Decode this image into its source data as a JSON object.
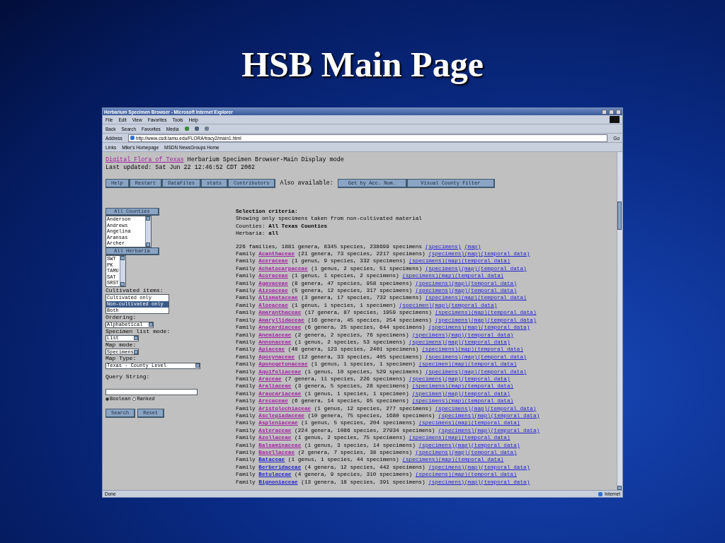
{
  "slide": {
    "title": "HSB Main Page"
  },
  "browser": {
    "title": "Herbarium Specimen Browser - Microsoft Internet Explorer",
    "menus": [
      "File",
      "Edit",
      "View",
      "Favorites",
      "Tools",
      "Help"
    ],
    "toolbar": [
      "Back",
      "Search",
      "Favorites",
      "Media"
    ],
    "address_label": "Address",
    "address": "http://www.csdl.tamu.edu/FLORA/tracy2/main1.html",
    "go": "Go",
    "links_label": "Links",
    "links": [
      "Mike's Homepage",
      "MSDN NewsGroups Home"
    ],
    "status": "Done",
    "zone": "Internet"
  },
  "page": {
    "site_link": "Digital Flora of Texas",
    "heading": "Herbarium Specimen Browser-Main Display mode",
    "updated": "Last updated: Sat Jun 22 12:46:52 CDT 2002",
    "nav_buttons": [
      "Help",
      "Restart",
      "DataFiles",
      "stats",
      "Contributors"
    ],
    "also_label": "Also available:",
    "extra_buttons": [
      "Get by Acc. Num.",
      "Visual County Filter"
    ],
    "form": {
      "counties_button": "All Counties",
      "counties": [
        "Anderson",
        "Andrews",
        "Angelina",
        "Aransas",
        "Archer"
      ],
      "herbaria_button": "All Herbaria",
      "herbaria": [
        "SWT",
        "PK",
        "TAMU",
        "SAT",
        "SRST"
      ],
      "cultivated_label": "Cultivated items:",
      "cultivated_options": [
        {
          "label": "Cultivated only",
          "selected": false
        },
        {
          "label": "Non-cultivated only",
          "selected": true
        },
        {
          "label": "Both",
          "selected": false
        }
      ],
      "ordering_label": "Ordering:",
      "ordering": "Alphabetical",
      "list_mode_label": "Specimen list mode:",
      "list_mode": "List",
      "map_mode_label": "Map mode:",
      "map_mode": "Specimens",
      "map_type_label": "Map Type:",
      "map_type": "Texas - County Level",
      "query_label": "Query String:",
      "query_modes": [
        {
          "label": "Boolean",
          "selected": true
        },
        {
          "label": "Ranked",
          "selected": false
        }
      ],
      "search_button": "Search",
      "reset_button": "Reset"
    },
    "results": {
      "criteria_title": "Selection criteria:",
      "criteria": "Showing only specimens taken from non-cultivated material",
      "counties_label": "Counties:",
      "counties_value": "All Texas Counties",
      "herbaria_label": "Herbaria:",
      "herbaria_value": "all",
      "summary": "226 families, 1881 genera, 8345 species, 238699 specimens",
      "summary_links": [
        "(specimens)",
        "(map)"
      ],
      "families": [
        {
          "prefix": "Family",
          "name": "Acanthaceae",
          "visited": true,
          "counts": "(21 genera, 73 species, 2217 specimens)",
          "links": [
            "(specimens)",
            "(map)",
            "(temporal data)"
          ]
        },
        {
          "prefix": "Family",
          "name": "Aceraceae",
          "visited": true,
          "counts": "(1 genus, 9 species, 332 specimens)",
          "links": [
            "(specimens)",
            "(map)",
            "(temporal data)"
          ]
        },
        {
          "prefix": "Family",
          "name": "Achatocarpaceae",
          "visited": true,
          "counts": "(1 genus, 2 species, 51 specimens)",
          "links": [
            "(specimens)",
            "(map)",
            "(temporal data)"
          ]
        },
        {
          "prefix": "Family",
          "name": "Acoraceae",
          "visited": true,
          "counts": "(1 genus, 1 species, 2 specimens)",
          "links": [
            "(specimens)",
            "(map)",
            "(temporal data)"
          ]
        },
        {
          "prefix": "Family",
          "name": "Agavaceae",
          "visited": true,
          "counts": "(8 genera, 47 species, 958 specimens)",
          "links": [
            "(specimens)",
            "(map)",
            "(temporal data)"
          ]
        },
        {
          "prefix": "Family",
          "name": "Aizoaceae",
          "visited": true,
          "counts": "(5 genera, 12 species, 317 specimens)",
          "links": [
            "(specimens)",
            "(map)",
            "(temporal data)"
          ]
        },
        {
          "prefix": "Family",
          "name": "Alismataceae",
          "visited": true,
          "counts": "(3 genera, 17 species, 732 specimens)",
          "links": [
            "(specimens)",
            "(map)",
            "(temporal data)"
          ]
        },
        {
          "prefix": "Family",
          "name": "Aloeaceae",
          "visited": true,
          "counts": "(1 genus, 1 species, 1 specimen)",
          "links": [
            "(specimen)",
            "(map)",
            "(temporal data)"
          ]
        },
        {
          "prefix": "Family",
          "name": "Amaranthaceae",
          "visited": true,
          "counts": "(17 genera, 87 species, 1959 specimens)",
          "links": [
            "(specimens)",
            "(map)",
            "(temporal data)"
          ]
        },
        {
          "prefix": "Family",
          "name": "Amaryllidaceae",
          "visited": true,
          "counts": "(16 genera, 45 species, 254 specimens)",
          "links": [
            "(specimens)",
            "(map)",
            "(temporal data)"
          ]
        },
        {
          "prefix": "Family",
          "name": "Anacardiaceae",
          "visited": true,
          "counts": "(6 genera, 25 species, 644 specimens)",
          "links": [
            "(specimens)",
            "(map)",
            "(temporal data)"
          ]
        },
        {
          "prefix": "Family",
          "name": "Anemiaceae",
          "visited": true,
          "counts": "(2 genera, 2 species, 76 specimens)",
          "links": [
            "(specimens)",
            "(map)",
            "(temporal data)"
          ]
        },
        {
          "prefix": "Family",
          "name": "Annonaceae",
          "visited": true,
          "counts": "(1 genus, 2 species, 53 specimens)",
          "links": [
            "(specimens)",
            "(map)",
            "(temporal data)"
          ]
        },
        {
          "prefix": "Family",
          "name": "Apiaceae",
          "visited": true,
          "counts": "(48 genera, 123 species, 2401 specimens)",
          "links": [
            "(specimens)",
            "(map)",
            "(temporal data)"
          ]
        },
        {
          "prefix": "Family",
          "name": "Apocynaceae",
          "visited": true,
          "counts": "(12 genera, 33 species, 405 specimens)",
          "links": [
            "(specimens)",
            "(map)",
            "(temporal data)"
          ]
        },
        {
          "prefix": "Family",
          "name": "Aponogetonaceae",
          "visited": true,
          "counts": "(1 genus, 1 species, 1 specimen)",
          "links": [
            "(specimen)",
            "(map)",
            "(temporal data)"
          ]
        },
        {
          "prefix": "Family",
          "name": "Aquifoliaceae",
          "visited": true,
          "counts": "(1 genus, 10 species, 529 specimens)",
          "links": [
            "(specimens)",
            "(map)",
            "(temporal data)"
          ]
        },
        {
          "prefix": "Family",
          "name": "Araceae",
          "visited": true,
          "counts": "(7 genera, 11 species, 226 specimens)",
          "links": [
            "(specimens)",
            "(map)",
            "(temporal data)"
          ]
        },
        {
          "prefix": "Family",
          "name": "Araliaceae",
          "visited": true,
          "counts": "(3 genera, 5 species, 28 specimens)",
          "links": [
            "(specimens)",
            "(map)",
            "(temporal data)"
          ]
        },
        {
          "prefix": "Family",
          "name": "Araucariaceae",
          "visited": true,
          "counts": "(1 genus, 1 species, 1 specimen)",
          "links": [
            "(specimen)",
            "(map)",
            "(temporal data)"
          ]
        },
        {
          "prefix": "Family",
          "name": "Arecaceae",
          "visited": true,
          "counts": "(6 genera, 14 species, 95 specimens)",
          "links": [
            "(specimens)",
            "(map)",
            "(temporal data)"
          ]
        },
        {
          "prefix": "Family",
          "name": "Aristolochiaceae",
          "visited": true,
          "counts": "(1 genus, 12 species, 277 specimens)",
          "links": [
            "(specimens)",
            "(map)",
            "(temporal data)"
          ]
        },
        {
          "prefix": "Family",
          "name": "Asclepiadaceae",
          "visited": true,
          "counts": "(10 genera, 75 species, 1680 specimens)",
          "links": [
            "(specimens)",
            "(map)",
            "(temporal data)"
          ]
        },
        {
          "prefix": "Family",
          "name": "Aspleniaceae",
          "visited": true,
          "counts": "(1 genus, 5 species, 204 specimens)",
          "links": [
            "(specimens)",
            "(map)",
            "(temporal data)"
          ]
        },
        {
          "prefix": "Family",
          "name": "Asteraceae",
          "visited": true,
          "counts": "(224 genera, 1086 species, 27934 specimens)",
          "links": [
            "(specimens)",
            "(map)",
            "(temporal data)"
          ]
        },
        {
          "prefix": "Family",
          "name": "Azollaceae",
          "visited": true,
          "counts": "(1 genus, 2 species, 75 specimens)",
          "links": [
            "(specimens)",
            "(map)",
            "(temporal data)"
          ]
        },
        {
          "prefix": "Family",
          "name": "Balsaminaceae",
          "visited": true,
          "counts": "(1 genus, 3 species, 14 specimens)",
          "links": [
            "(specimens)",
            "(map)",
            "(temporal data)"
          ]
        },
        {
          "prefix": "Family",
          "name": "Basellaceae",
          "visited": true,
          "counts": "(2 genera, 7 species, 38 specimens)",
          "links": [
            "(specimens)",
            "(map)",
            "(temporal data)"
          ]
        },
        {
          "prefix": "Family",
          "name": "Bataceae",
          "visited": false,
          "counts": "(1 genus, 1 species, 44 specimens)",
          "links": [
            "(specimens)",
            "(map)",
            "(temporal data)"
          ]
        },
        {
          "prefix": "Family",
          "name": "Berberidaceae",
          "visited": false,
          "counts": "(4 genera, 12 species, 442 specimens)",
          "links": [
            "(specimens)",
            "(map)",
            "(temporal data)"
          ]
        },
        {
          "prefix": "Family",
          "name": "Betulaceae",
          "visited": false,
          "counts": "(4 genera, 9 species, 310 specimens)",
          "links": [
            "(specimens)",
            "(map)",
            "(temporal data)"
          ]
        },
        {
          "prefix": "Family",
          "name": "Bignoniaceae",
          "visited": false,
          "counts": "(13 genera, 18 species, 391 specimens)",
          "links": [
            "(specimens)",
            "(map)",
            "(temporal data)"
          ]
        }
      ]
    }
  }
}
